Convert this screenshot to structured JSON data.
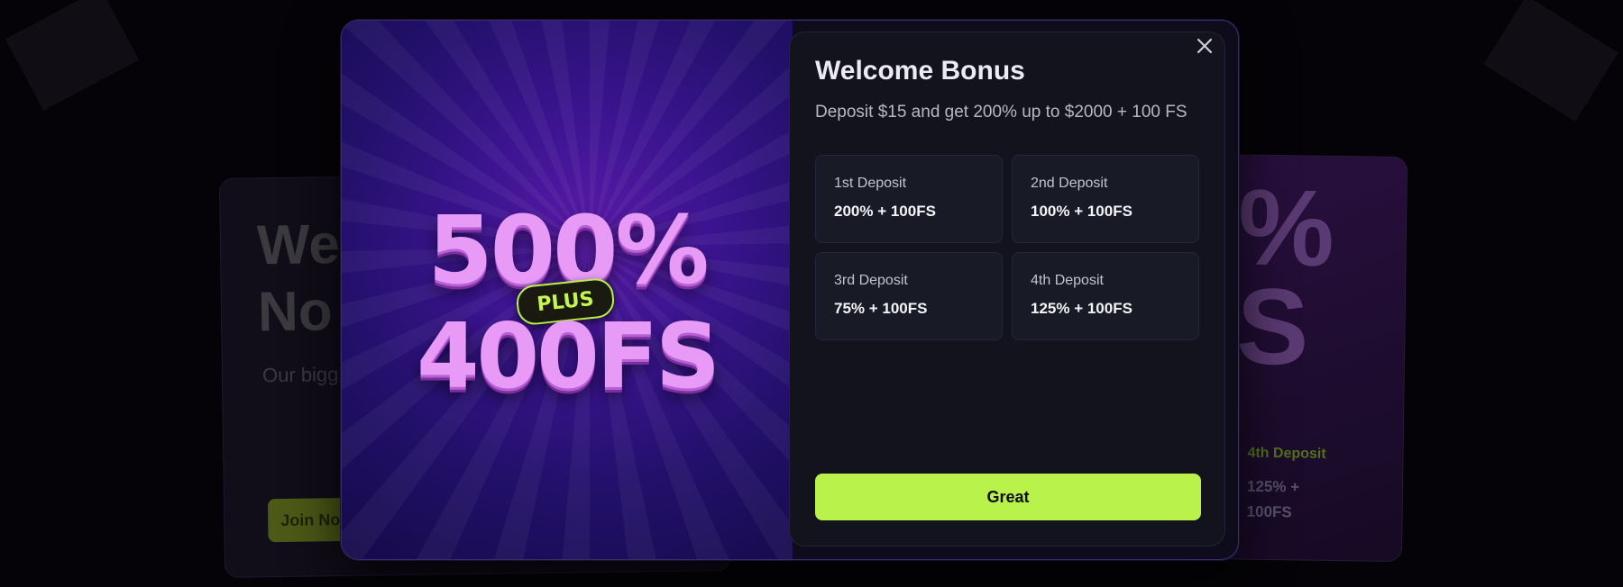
{
  "background": {
    "left_card": {
      "headline_line1": "We",
      "headline_line2": "No",
      "subtitle": "Our bigg",
      "join_label": "Join Now"
    },
    "right_card": {
      "big_line1": "%",
      "big_line2": "S",
      "deposit_label": "4th Deposit",
      "deposit_value": "125% + 100FS"
    }
  },
  "modal": {
    "promo": {
      "line1": "500%",
      "badge": "PLUS",
      "line2": "400FS"
    },
    "title": "Welcome Bonus",
    "subtitle": "Deposit $15 and get 200% up to $2000 + 100 FS",
    "deposits": [
      {
        "label": "1st Deposit",
        "value": "200% + 100FS"
      },
      {
        "label": "2nd Deposit",
        "value": "100% + 100FS"
      },
      {
        "label": "3rd Deposit",
        "value": "75% + 100FS"
      },
      {
        "label": "4th Deposit",
        "value": "125% + 100FS"
      }
    ],
    "button_label": "Great",
    "close_icon": "close-icon"
  },
  "colors": {
    "accent": "#b9f24a",
    "promo_text": "#e79bf7",
    "panel_bg": "#12131c"
  }
}
